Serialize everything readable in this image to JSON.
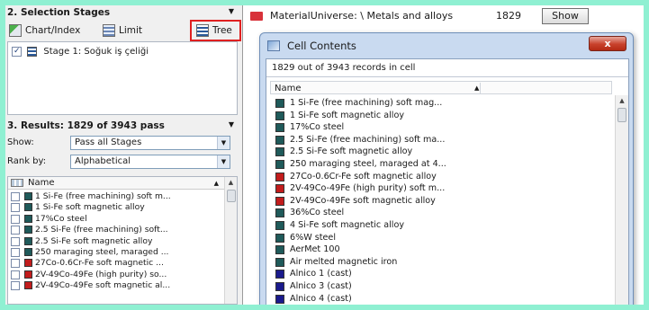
{
  "colors": {
    "dark_teal": "#1f5a5a",
    "red": "#c21c1c",
    "navy": "#1a1a8c"
  },
  "selection": {
    "title": "2. Selection Stages",
    "tools": [
      "Chart/Index",
      "Limit",
      "Tree"
    ],
    "stage": "Stage 1: Soğuk iş çeliği"
  },
  "results": {
    "title": "3. Results: 1829 of 3943 pass",
    "show_label": "Show:",
    "show_value": "Pass all Stages",
    "rank_label": "Rank by:",
    "rank_value": "Alphabetical",
    "column": "Name",
    "items": [
      {
        "name": "1 Si-Fe (free machining) soft m...",
        "color": "dark_teal"
      },
      {
        "name": "1 Si-Fe soft magnetic alloy",
        "color": "dark_teal"
      },
      {
        "name": "17%Co steel",
        "color": "dark_teal"
      },
      {
        "name": "2.5 Si-Fe (free machining) soft...",
        "color": "dark_teal"
      },
      {
        "name": "2.5 Si-Fe soft magnetic alloy",
        "color": "dark_teal"
      },
      {
        "name": "250 maraging steel, maraged ...",
        "color": "dark_teal"
      },
      {
        "name": "27Co-0.6Cr-Fe soft magnetic ...",
        "color": "red"
      },
      {
        "name": "2V-49Co-49Fe (high purity) so...",
        "color": "red"
      },
      {
        "name": "2V-49Co-49Fe soft magnetic al...",
        "color": "red"
      }
    ]
  },
  "header": {
    "path": "MaterialUniverse: \\ Metals and alloys",
    "count": "1829",
    "show_button": "Show"
  },
  "cell_window": {
    "title": "Cell Contents",
    "close": "x",
    "record_count": "1829 out of 3943 records in cell",
    "column": "Name",
    "items": [
      {
        "name": "1 Si-Fe (free machining) soft mag...",
        "color": "dark_teal"
      },
      {
        "name": "1 Si-Fe soft magnetic alloy",
        "color": "dark_teal"
      },
      {
        "name": "17%Co steel",
        "color": "dark_teal"
      },
      {
        "name": "2.5 Si-Fe (free machining) soft ma...",
        "color": "dark_teal"
      },
      {
        "name": "2.5 Si-Fe soft magnetic alloy",
        "color": "dark_teal"
      },
      {
        "name": "250 maraging steel, maraged at 4...",
        "color": "dark_teal"
      },
      {
        "name": "27Co-0.6Cr-Fe soft magnetic alloy",
        "color": "red"
      },
      {
        "name": "2V-49Co-49Fe (high purity) soft m...",
        "color": "red"
      },
      {
        "name": "2V-49Co-49Fe soft magnetic alloy",
        "color": "red"
      },
      {
        "name": "36%Co steel",
        "color": "dark_teal"
      },
      {
        "name": "4 Si-Fe soft magnetic alloy",
        "color": "dark_teal"
      },
      {
        "name": "6%W steel",
        "color": "dark_teal"
      },
      {
        "name": "AerMet 100",
        "color": "dark_teal"
      },
      {
        "name": "Air melted magnetic iron",
        "color": "dark_teal"
      },
      {
        "name": "Alnico 1 (cast)",
        "color": "navy"
      },
      {
        "name": "Alnico 3 (cast)",
        "color": "navy"
      },
      {
        "name": "Alnico 4 (cast)",
        "color": "navy"
      }
    ]
  }
}
